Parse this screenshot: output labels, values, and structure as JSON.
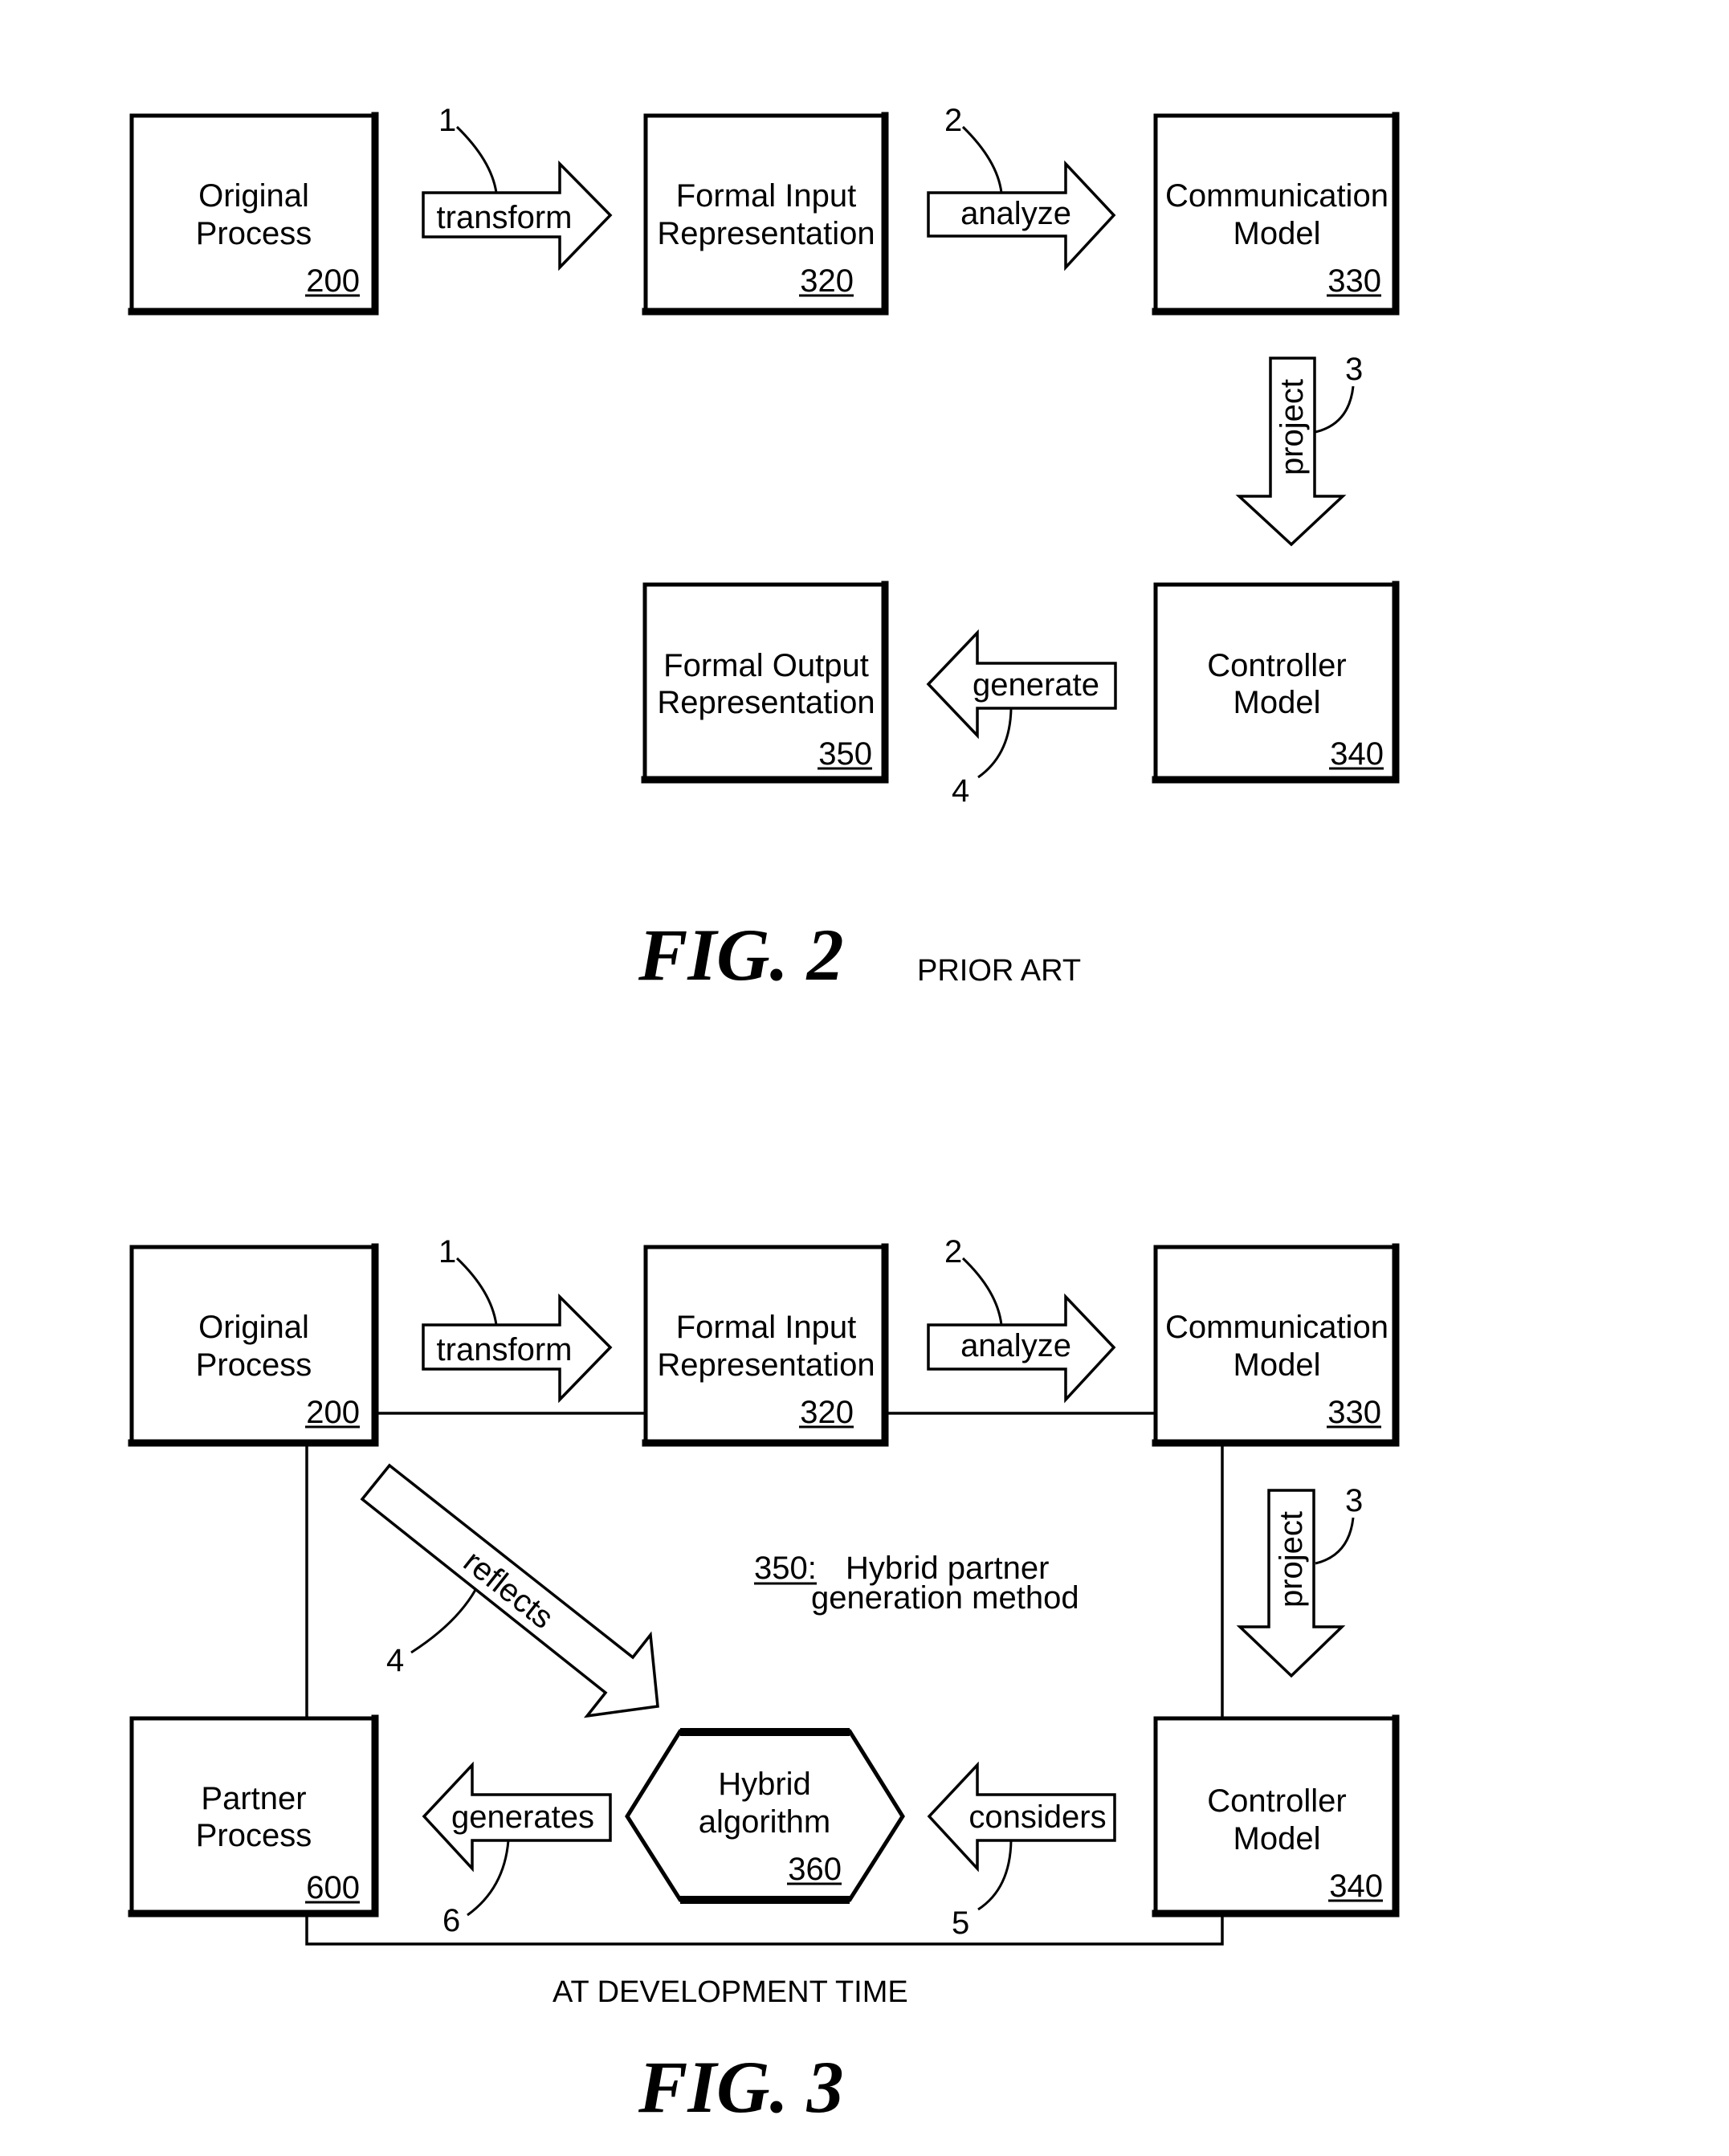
{
  "fig2": {
    "title": "FIG. 2",
    "subtitle": "PRIOR ART",
    "boxes": {
      "original_process": {
        "line1": "Original",
        "line2": "Process",
        "ref": "200"
      },
      "formal_input": {
        "line1": "Formal Input",
        "line2": "Representation",
        "ref": "320"
      },
      "communication_model": {
        "line1": "Communication",
        "line2": "Model",
        "ref": "330"
      },
      "controller_model": {
        "line1": "Controller",
        "line2": "Model",
        "ref": "340"
      },
      "formal_output": {
        "line1": "Formal Output",
        "line2": "Representation",
        "ref": "350"
      }
    },
    "arrows": {
      "transform": {
        "label": "transform",
        "step": "1"
      },
      "analyze": {
        "label": "analyze",
        "step": "2"
      },
      "project": {
        "label": "project",
        "step": "3"
      },
      "generate": {
        "label": "generate",
        "step": "4"
      }
    }
  },
  "fig3": {
    "title": "FIG. 3",
    "footer": "AT DEVELOPMENT TIME",
    "method": {
      "ref": "350:",
      "line1": "Hybrid partner",
      "line2": "generation method"
    },
    "boxes": {
      "original_process": {
        "line1": "Original",
        "line2": "Process",
        "ref": "200"
      },
      "formal_input": {
        "line1": "Formal Input",
        "line2": "Representation",
        "ref": "320"
      },
      "communication_model": {
        "line1": "Communication",
        "line2": "Model",
        "ref": "330"
      },
      "controller_model": {
        "line1": "Controller",
        "line2": "Model",
        "ref": "340"
      },
      "partner_process": {
        "line1": "Partner",
        "line2": "Process",
        "ref": "600"
      },
      "hybrid_algorithm": {
        "line1": "Hybrid",
        "line2": "algorithm",
        "ref": "360"
      }
    },
    "arrows": {
      "transform": {
        "label": "transform",
        "step": "1"
      },
      "analyze": {
        "label": "analyze",
        "step": "2"
      },
      "project": {
        "label": "project",
        "step": "3"
      },
      "reflects": {
        "label": "reflects",
        "step": "4"
      },
      "considers": {
        "label": "considers",
        "step": "5"
      },
      "generates": {
        "label": "generates",
        "step": "6"
      }
    }
  }
}
